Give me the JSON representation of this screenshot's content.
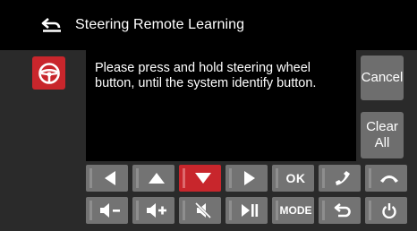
{
  "header": {
    "title": "Steering Remote Learning",
    "back_icon": "back-arrow-icon"
  },
  "message": "Please press and hold steering wheel button, until the system identify button.",
  "buttons": {
    "cancel": "Cancel",
    "clear": "Clear\nAll"
  },
  "keys_row1": [
    {
      "icon": "prev-left-icon",
      "active": false
    },
    {
      "icon": "up-arrow-icon",
      "active": false
    },
    {
      "icon": "down-arrow-icon",
      "active": true
    },
    {
      "icon": "next-right-icon",
      "active": false
    },
    {
      "label": "OK"
    },
    {
      "icon": "phone-answer-icon",
      "active": false
    },
    {
      "icon": "phone-hangup-icon",
      "active": false
    }
  ],
  "keys_row2": [
    {
      "icon": "volume-down-icon"
    },
    {
      "icon": "volume-up-icon"
    },
    {
      "icon": "mute-icon"
    },
    {
      "icon": "play-pause-icon"
    },
    {
      "label": "MODE"
    },
    {
      "icon": "return-icon"
    },
    {
      "icon": "power-icon"
    }
  ],
  "colors": {
    "accent": "#c8262c",
    "key_bg": "#737373",
    "side_bg": "#6e6e6e",
    "panel": "#000000",
    "background": "#2a2a2a"
  }
}
